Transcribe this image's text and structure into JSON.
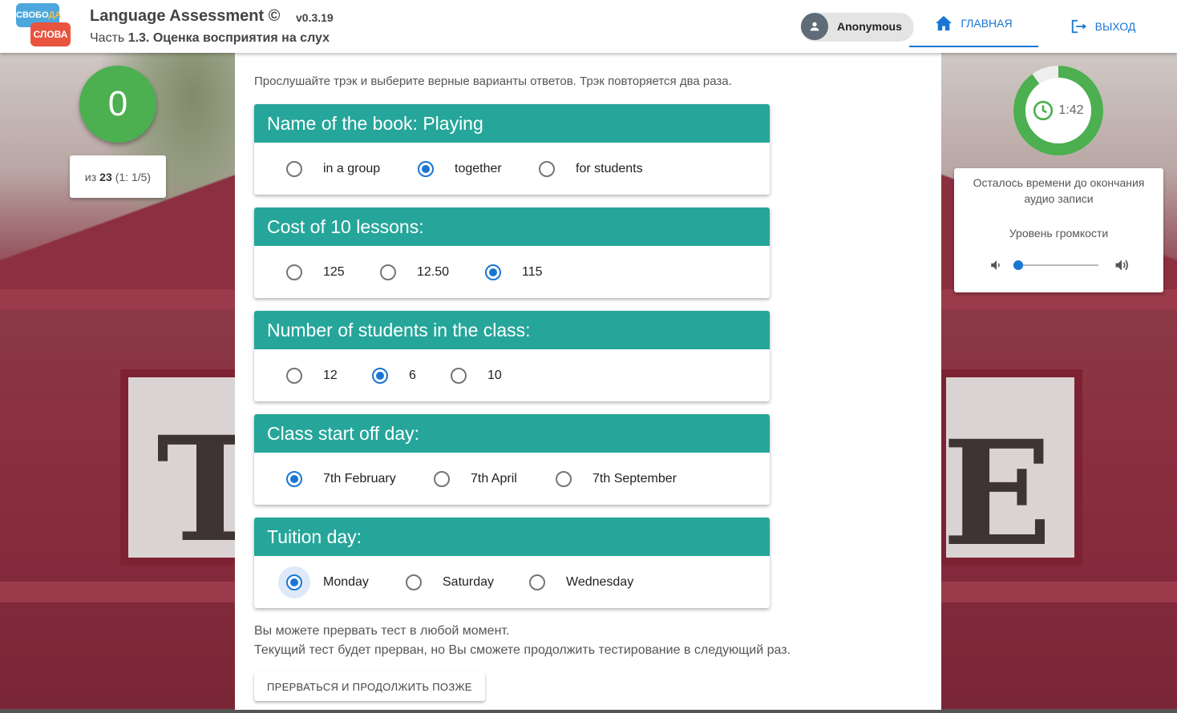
{
  "header": {
    "logo_top": "СВОБО",
    "logo_top_accent": "ДА",
    "logo_bottom": "СЛОВА",
    "app_title": "Language Assessment ©",
    "version": "v0.3.19",
    "part_prefix": "Часть",
    "part_number": "1.3.",
    "part_title": "Оценка восприятия на слух",
    "user_name": "Anonymous",
    "nav_home": "ГЛАВНАЯ",
    "nav_exit": "ВЫХОД"
  },
  "score": {
    "value": "0",
    "of_label": "из",
    "total": "23",
    "detail": "(1: 1/5)"
  },
  "instructions": "Прослушайте трэк и выберите верные варианты ответов. Трэк повторяется два раза.",
  "questions": [
    {
      "title": "Name of the book: Playing",
      "options": [
        "in a group",
        "together",
        "for students"
      ],
      "selected": 1
    },
    {
      "title": "Cost of 10 lessons:",
      "options": [
        "125",
        "12.50",
        "115"
      ],
      "selected": 2
    },
    {
      "title": "Number of students in the class:",
      "options": [
        "12",
        "6",
        "10"
      ],
      "selected": 1
    },
    {
      "title": "Class start off day:",
      "options": [
        "7th February",
        "7th April",
        "7th September"
      ],
      "selected": 0
    },
    {
      "title": "Tuition day:",
      "options": [
        "Monday",
        "Saturday",
        "Wednesday"
      ],
      "selected": 0
    }
  ],
  "note_line1": "Вы можете прервать тест в любой момент.",
  "note_line2": "Текущий тест будет прерван, но Вы сможете продолжить тестирование в следующий раз.",
  "defer_button": "ПРЕРВАТЬСЯ И ПРОДОЛЖИТЬ ПОЗЖЕ",
  "timer": {
    "time_left": "1:42",
    "remaining_fraction": 0.9,
    "label": "Осталось времени до окончания аудио записи",
    "volume_label": "Уровень громкости",
    "volume_level": 0.0
  },
  "colors": {
    "accent": "#1976d2",
    "question_header": "#26a69a",
    "score_green": "#4caf50",
    "timer_green": "#4caf50"
  },
  "icons": {
    "home": "home-icon",
    "exit": "logout-icon",
    "user": "person-icon",
    "timer": "clock-icon",
    "volume_low": "volume-low-icon",
    "volume_high": "volume-high-icon"
  }
}
